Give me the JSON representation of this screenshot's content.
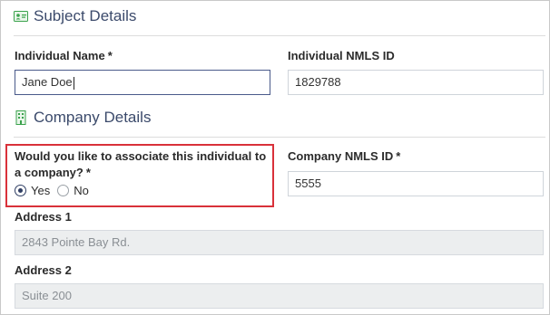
{
  "subject_section": {
    "title": "Subject Details",
    "icon": "id-card-icon",
    "individual_name": {
      "label": "Individual Name",
      "required": "*",
      "value": "Jane Doe"
    },
    "individual_nmls": {
      "label": "Individual NMLS ID",
      "value": "1829788"
    }
  },
  "company_section": {
    "title": "Company Details",
    "icon": "building-icon",
    "associate_question": {
      "label_line1": "Would you like to associate this individual to",
      "label_line2": "a company?",
      "required": "*",
      "options": [
        {
          "label": "Yes",
          "selected": true
        },
        {
          "label": "No",
          "selected": false
        }
      ]
    },
    "company_nmls": {
      "label": "Company NMLS ID",
      "required": "*",
      "value": "5555"
    },
    "address1": {
      "label": "Address 1",
      "value": "2843 Pointe Bay Rd."
    },
    "address2": {
      "label": "Address 2",
      "value": "Suite 200"
    }
  },
  "colors": {
    "heading": "#3b4a6b",
    "icon_green": "#3aa24c",
    "highlight_border": "#d9313a",
    "readonly_bg": "#eceeef"
  }
}
